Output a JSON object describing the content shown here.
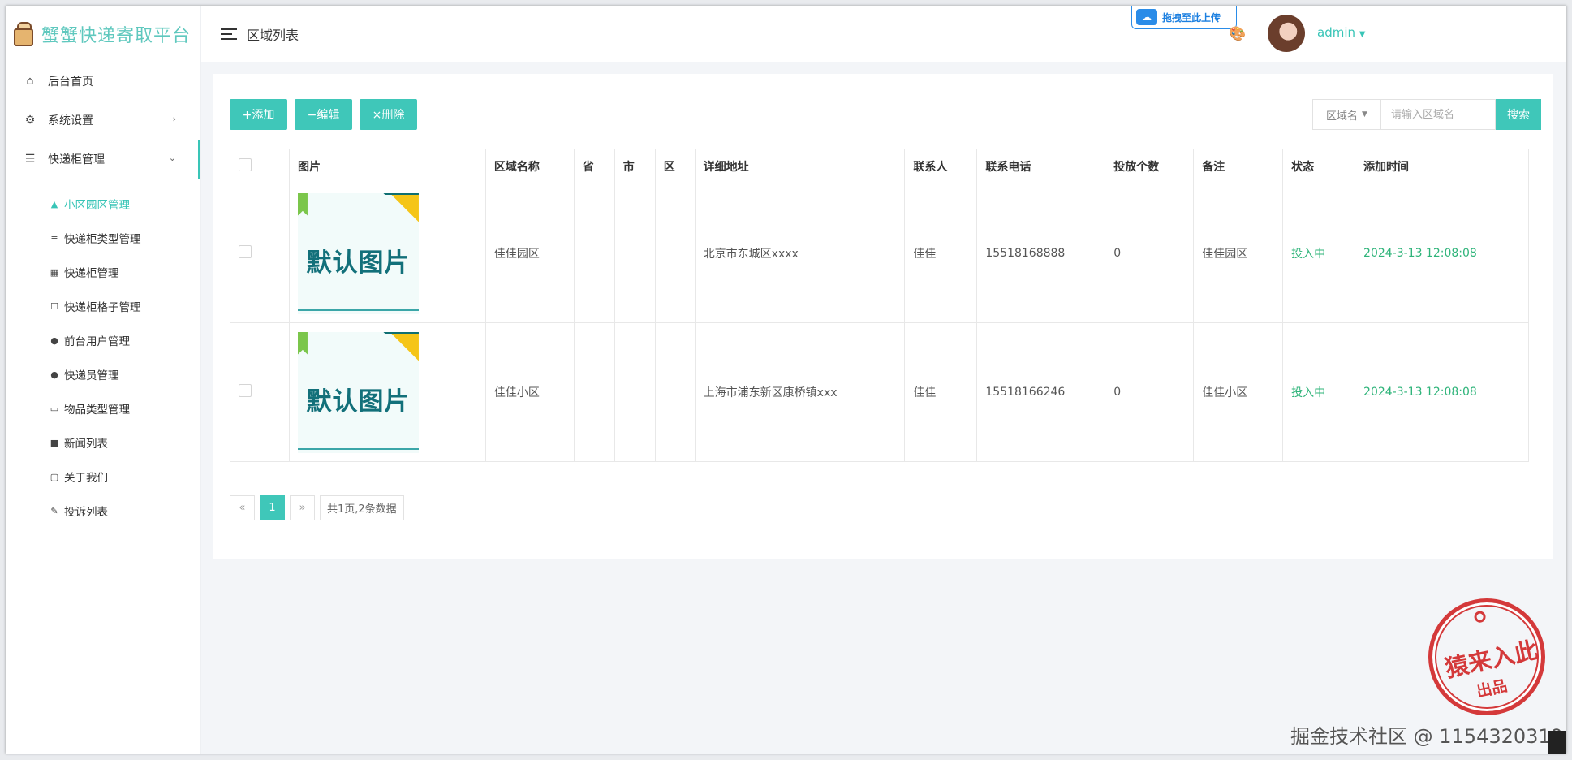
{
  "brand": {
    "title": "蟹蟹快递寄取平台"
  },
  "header": {
    "page_title": "区域列表",
    "upload_badge": "拖拽至此上传",
    "user_name": "admin"
  },
  "sidebar": {
    "items": [
      {
        "label": "后台首页",
        "icon": "home-icon"
      },
      {
        "label": "系统设置",
        "icon": "gear-icon"
      },
      {
        "label": "快递柜管理",
        "icon": "list-icon"
      }
    ],
    "submenu": [
      {
        "label": "小区园区管理",
        "icon": "triangle-icon"
      },
      {
        "label": "快递柜类型管理",
        "icon": "menu-lines-icon"
      },
      {
        "label": "快递柜管理",
        "icon": "keyboard-icon"
      },
      {
        "label": "快递柜格子管理",
        "icon": "square-icon"
      },
      {
        "label": "前台用户管理",
        "icon": "user-icon"
      },
      {
        "label": "快递员管理",
        "icon": "user-icon"
      },
      {
        "label": "物品类型管理",
        "icon": "folder-icon"
      },
      {
        "label": "新闻列表",
        "icon": "file-icon"
      },
      {
        "label": "关于我们",
        "icon": "comment-icon"
      },
      {
        "label": "投诉列表",
        "icon": "pencil-icon"
      }
    ]
  },
  "toolbar": {
    "add_label": "+添加",
    "edit_label": "−编辑",
    "delete_label": "×删除",
    "search_field_select": "区域名",
    "search_placeholder": "请输入区域名",
    "search_button": "搜索"
  },
  "table": {
    "columns": [
      "图片",
      "区域名称",
      "省",
      "市",
      "区",
      "详细地址",
      "联系人",
      "联系电话",
      "投放个数",
      "备注",
      "状态",
      "添加时间"
    ],
    "rows": [
      {
        "image_text": "默认图片",
        "name": "佳佳园区",
        "province": "",
        "city": "",
        "district": "",
        "address": "北京市东城区xxxx",
        "contact": "佳佳",
        "phone": "15518168888",
        "count": "0",
        "remark": "佳佳园区",
        "status": "投入中",
        "added": "2024-3-13 12:08:08"
      },
      {
        "image_text": "默认图片",
        "name": "佳佳小区",
        "province": "",
        "city": "",
        "district": "",
        "address": "上海市浦东新区康桥镇xxx",
        "contact": "佳佳",
        "phone": "15518166246",
        "count": "0",
        "remark": "佳佳小区",
        "status": "投入中",
        "added": "2024-3-13 12:08:08"
      }
    ]
  },
  "pagination": {
    "prev": "«",
    "current": "1",
    "next": "»",
    "info": "共1页,2条数据"
  },
  "watermark": {
    "text": "掘金技术社区 @ 1154320319",
    "stamp_text_1": "猿来入此",
    "stamp_text_2": "出品"
  },
  "colors": {
    "accent": "#3fc7b9",
    "status_green": "#2fb47a",
    "stamp_red": "#d22a2a"
  }
}
